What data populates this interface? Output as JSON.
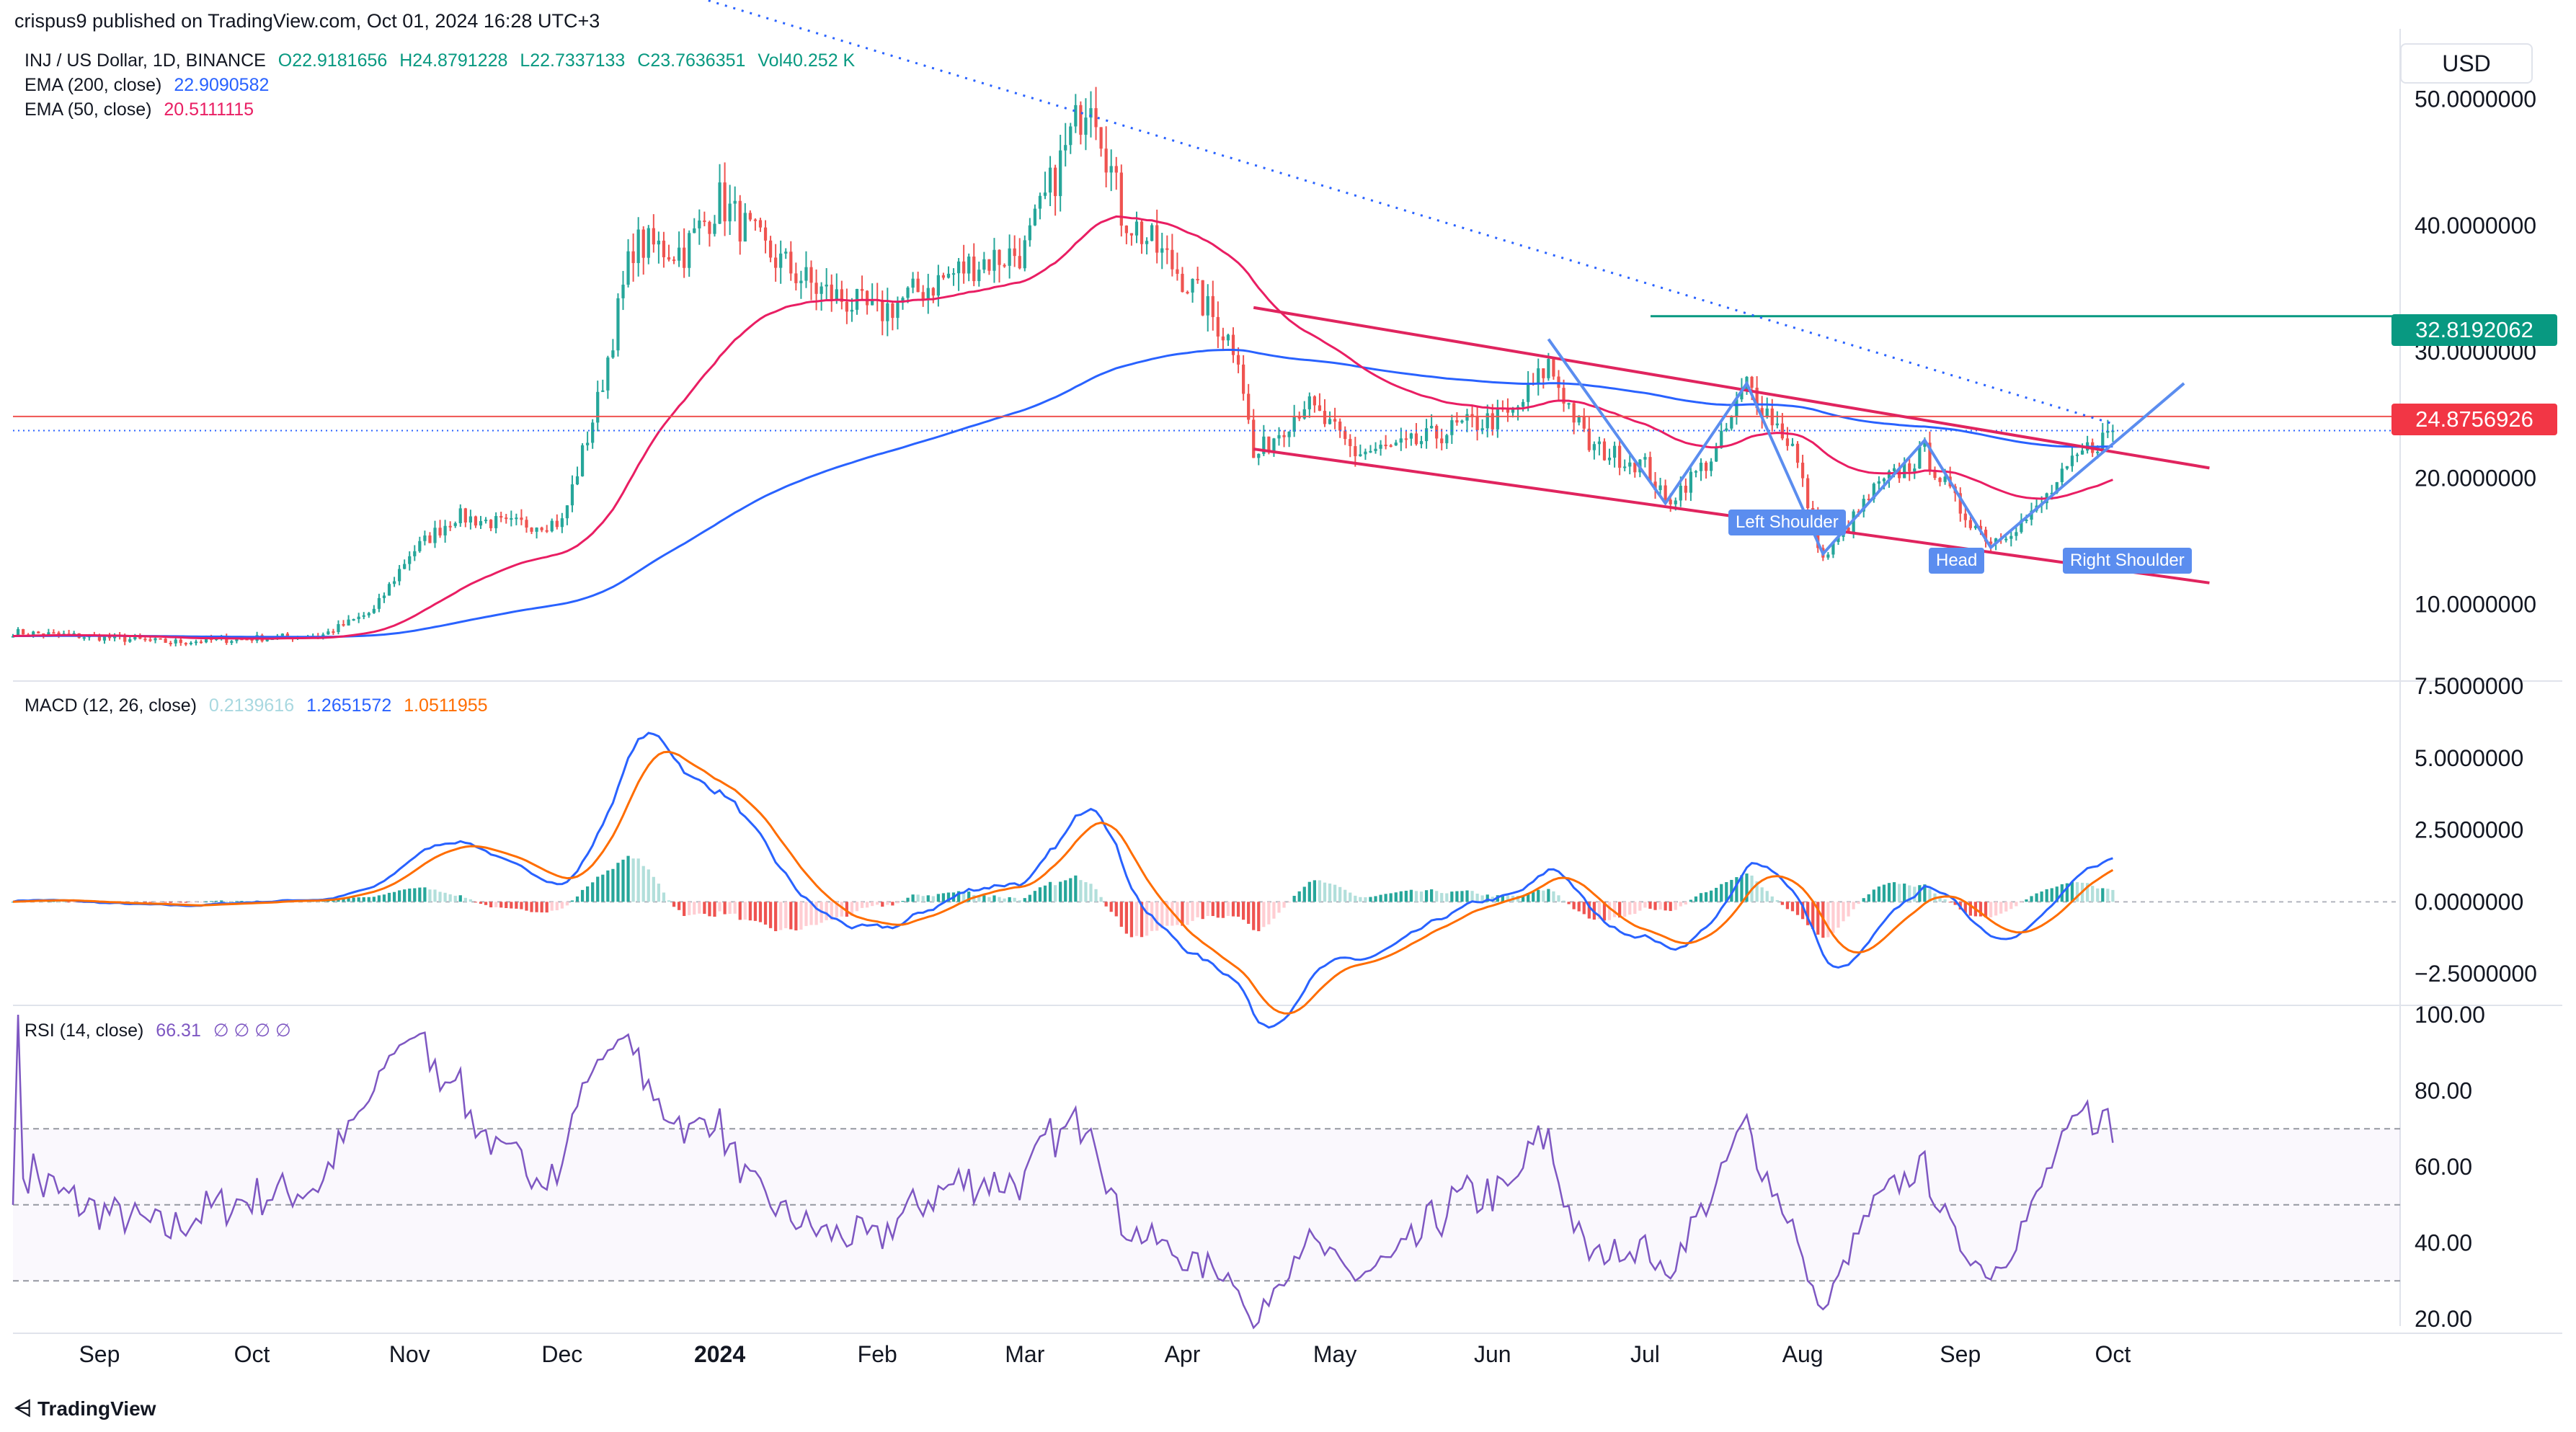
{
  "header": {
    "publisher_line": "crispus9 published on TradingView.com, Oct 01, 2024 16:28 UTC+3"
  },
  "legend": {
    "symbol": "INJ / US Dollar, 1D, BINANCE",
    "ohlc": {
      "O": "O22.9181656",
      "H": "H24.8791228",
      "L": "L22.7337133",
      "C": "C23.7636351",
      "Vol": "Vol40.252 K"
    },
    "ema200": {
      "label": "EMA (200, close)",
      "value": "22.9090582"
    },
    "ema50": {
      "label": "EMA (50, close)",
      "value": "20.5111115"
    },
    "macd": {
      "label": "MACD (12, 26, close)",
      "hist": "0.2139616",
      "macd": "1.2651572",
      "signal": "1.0511955"
    },
    "rsi": {
      "label": "RSI (14, close)",
      "value": "66.31",
      "extra": "∅ ∅ ∅ ∅"
    }
  },
  "currency_button": "USD",
  "price_tags": {
    "target": "32.8192062",
    "current": "24.8756926"
  },
  "pattern_labels": {
    "left": "Left Shoulder",
    "head": "Head",
    "right": "Right Shoulder"
  },
  "footer": {
    "brand": "TradingView"
  },
  "colors": {
    "up": "#26a69a",
    "down": "#ef5350",
    "ema200": "#2962ff",
    "ema50": "#e91e63",
    "channel": "#e0245e",
    "macd": "#2962ff",
    "signal": "#ff6d00",
    "rsi": "#7e57c2",
    "target": "#089981",
    "pattern": "#5b8def"
  },
  "chart_data": [
    {
      "type": "candlestick",
      "title": "INJ / US Dollar, 1D, BINANCE",
      "x_ticks": [
        "Sep",
        "Oct",
        "Nov",
        "Dec",
        "2024",
        "Feb",
        "Mar",
        "Apr",
        "May",
        "Jun",
        "Jul",
        "Aug",
        "Sep",
        "Oct"
      ],
      "y_ticks": [
        "50.0000000",
        "40.0000000",
        "30.0000000",
        "20.0000000",
        "10.0000000"
      ],
      "ylim": [
        4.5,
        55
      ],
      "approx_close_series": {
        "dates": [
          "2023-08-15",
          "2023-09-01",
          "2023-09-15",
          "2023-10-01",
          "2023-10-15",
          "2023-10-25",
          "2023-11-01",
          "2023-11-10",
          "2023-11-20",
          "2023-12-01",
          "2023-12-08",
          "2023-12-15",
          "2023-12-25",
          "2024-01-01",
          "2024-01-10",
          "2024-01-20",
          "2024-02-01",
          "2024-02-10",
          "2024-02-20",
          "2024-03-01",
          "2024-03-08",
          "2024-03-14",
          "2024-03-20",
          "2024-04-01",
          "2024-04-12",
          "2024-04-15",
          "2024-04-25",
          "2024-05-05",
          "2024-05-15",
          "2024-05-25",
          "2024-06-05",
          "2024-06-12",
          "2024-06-20",
          "2024-07-01",
          "2024-07-05",
          "2024-07-15",
          "2024-07-21",
          "2024-07-30",
          "2024-08-05",
          "2024-08-15",
          "2024-08-25",
          "2024-09-01",
          "2024-09-07",
          "2024-09-15",
          "2024-09-25",
          "2024-10-01"
        ],
        "values": [
          7.8,
          7.4,
          7.0,
          7.3,
          7.6,
          9.5,
          14.0,
          17.0,
          16.3,
          16.5,
          26.0,
          38.5,
          38.0,
          42.0,
          38.0,
          35.0,
          33.0,
          35.0,
          37.0,
          38.0,
          45.0,
          51.0,
          41.0,
          36.0,
          30.0,
          21.5,
          26.0,
          22.0,
          22.5,
          24.0,
          25.0,
          29.0,
          22.5,
          21.0,
          18.0,
          22.0,
          27.5,
          22.5,
          13.5,
          19.0,
          22.0,
          17.5,
          15.0,
          17.0,
          22.0,
          23.76
        ]
      },
      "horizontal_lines": {
        "target": 32.8192062,
        "current": 24.8756926
      },
      "indicators": [
        {
          "name": "EMA (200, close)",
          "last": 22.9090582
        },
        {
          "name": "EMA (50, close)",
          "last": 20.5111115
        }
      ],
      "annotations": [
        "Left Shoulder",
        "Head",
        "Right Shoulder"
      ]
    },
    {
      "type": "line",
      "title": "MACD (12, 26, close)",
      "y_ticks": [
        "7.5000000",
        "5.0000000",
        "2.5000000",
        "0.0000000",
        "−2.5000000"
      ],
      "ylim": [
        -3.6,
        7.6
      ],
      "series": [
        {
          "name": "MACD",
          "last": 1.2651572
        },
        {
          "name": "Signal",
          "last": 1.0511955
        },
        {
          "name": "Histogram",
          "last": 0.2139616
        }
      ]
    },
    {
      "type": "line",
      "title": "RSI (14, close)",
      "y_ticks": [
        "100.00",
        "80.00",
        "60.00",
        "40.00",
        "20.00"
      ],
      "ylim": [
        20,
        100
      ],
      "levels": [
        70,
        50,
        30
      ],
      "series": [
        {
          "name": "RSI",
          "last": 66.31
        }
      ]
    }
  ]
}
